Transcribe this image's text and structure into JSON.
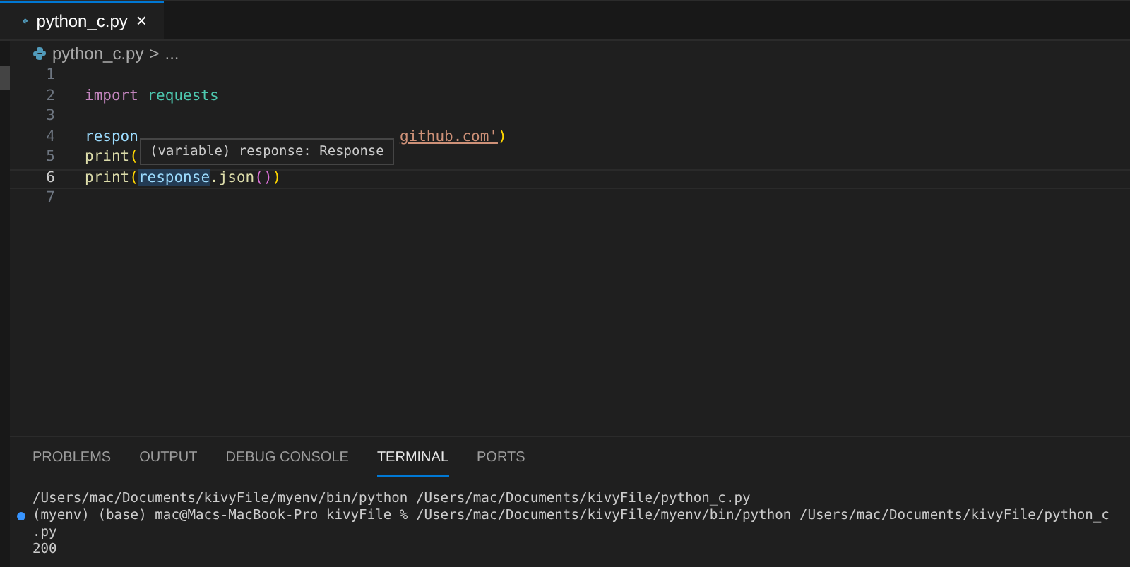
{
  "editor_tabs": [
    {
      "label": "python_c.py",
      "close": "×",
      "selected": true
    }
  ],
  "breadcrumb": {
    "file": "python_c.py",
    "separator": ">",
    "rest": "..."
  },
  "editor_lines": [
    {
      "number": "1",
      "active": false
    },
    {
      "number": "2",
      "active": false,
      "tokens": [
        {
          "kind": "keyword",
          "text": "import"
        },
        {
          "kind": "module",
          "text": "requests"
        }
      ]
    },
    {
      "number": "3",
      "active": false
    },
    {
      "number": "4",
      "active": false,
      "tokens": [
        {
          "kind": "variable",
          "text": "respon"
        },
        {
          "kind": "string_after_tooltip",
          "text": "github.com'"
        },
        {
          "kind": "paren",
          "text": ")"
        }
      ]
    },
    {
      "number": "5",
      "active": false,
      "tokens": [
        {
          "kind": "function",
          "text": "print"
        },
        {
          "kind": "paren",
          "text": "("
        }
      ]
    },
    {
      "number": "6",
      "active": true,
      "tokens": [
        {
          "kind": "function",
          "text": "print"
        },
        {
          "kind": "paren",
          "text": "("
        },
        {
          "kind": "hovered",
          "text": "response"
        },
        {
          "kind": "function",
          "text": ".json"
        },
        {
          "kind": "paren2",
          "text": "()"
        },
        {
          "kind": "paren",
          "text": ")"
        }
      ]
    },
    {
      "number": "7",
      "active": false
    }
  ],
  "hover_tooltip": "(variable) response: Response",
  "panel_tabs": [
    {
      "label": "PROBLEMS",
      "selected": false
    },
    {
      "label": "OUTPUT",
      "selected": false
    },
    {
      "label": "DEBUG CONSOLE",
      "selected": false
    },
    {
      "label": "TERMINAL",
      "selected": true
    },
    {
      "label": "PORTS",
      "selected": false
    }
  ],
  "terminal_lines": [
    {
      "text": "/Users/mac/Documents/kivyFile/myenv/bin/python /Users/mac/Documents/kivyFile/python_c.py",
      "marker": false
    },
    {
      "text": "(myenv) (base) mac@Macs-MacBook-Pro kivyFile % /Users/mac/Documents/kivyFile/myenv/bin/python /Users/mac/Documents/kivyFile/python_c",
      "marker": true
    },
    {
      "text": ".py",
      "marker": false
    },
    {
      "text": "200",
      "marker": false
    }
  ]
}
